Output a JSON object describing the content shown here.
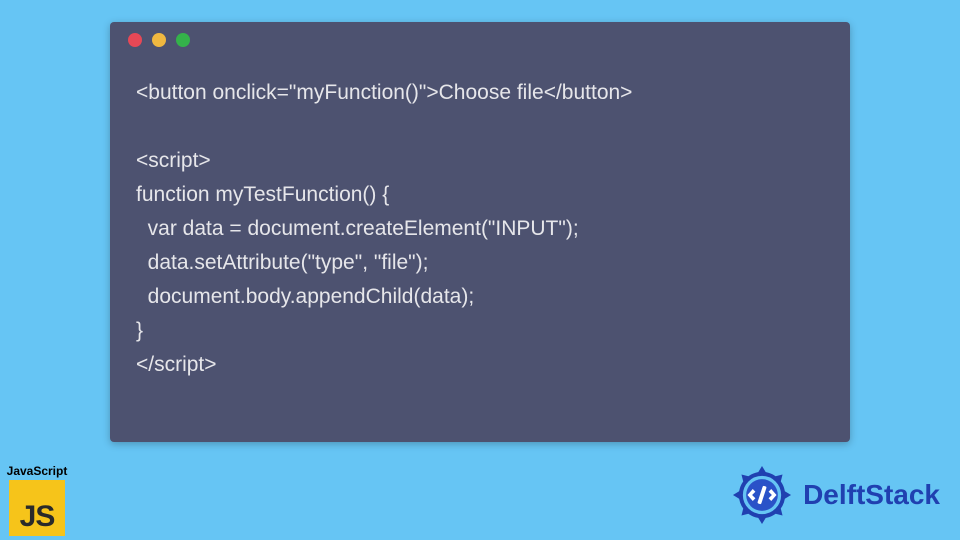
{
  "code": {
    "lines": [
      "<button onclick=\"myFunction()\">Choose file</button>",
      "",
      "<script>",
      "function myTestFunction() {",
      "  var data = document.createElement(\"INPUT\");",
      "  data.setAttribute(\"type\", \"file\");",
      "  document.body.appendChild(data);",
      "}",
      "</script>"
    ]
  },
  "js_badge": {
    "label": "JavaScript",
    "icon_text": "JS"
  },
  "brand": {
    "name": "DelftStack"
  },
  "colors": {
    "page_bg": "#66c5f4",
    "window_bg": "#4d5270",
    "code_text": "#e6e6ea",
    "dot_red": "#e74856",
    "dot_yellow": "#f0b840",
    "dot_green": "#34b24a",
    "js_yellow": "#f6c41a",
    "brand_blue": "#2040b0"
  }
}
